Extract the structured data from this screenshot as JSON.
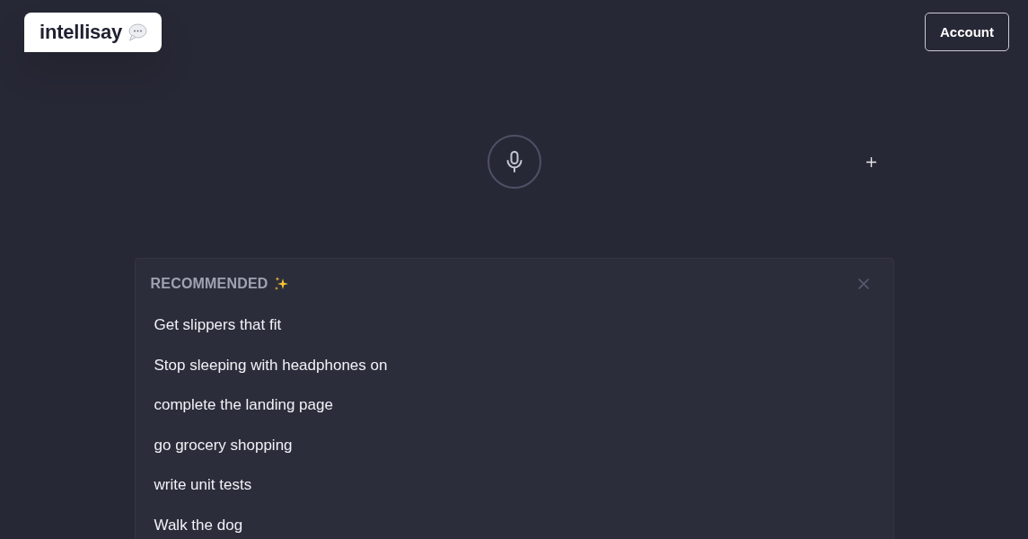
{
  "header": {
    "logo": {
      "name": "intellisay"
    },
    "account_button": "Account"
  },
  "recommended": {
    "title": "RECOMMENDED",
    "items": [
      "Get slippers that fit",
      "Stop sleeping with headphones on",
      "complete the landing page",
      "go grocery shopping",
      "write unit tests",
      "Walk the dog"
    ]
  }
}
